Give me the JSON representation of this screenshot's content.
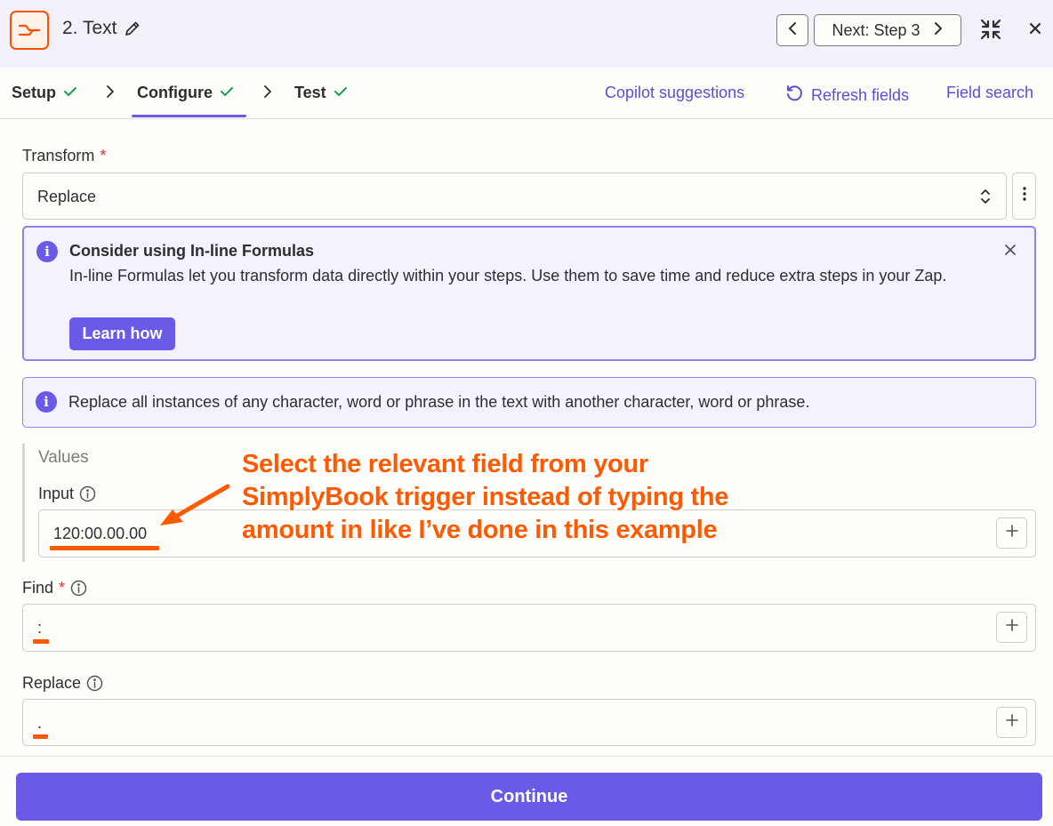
{
  "header": {
    "step_title": "2. Text",
    "next_label": "Next: Step 3",
    "icons": {
      "app": "text-formatter-icon",
      "edit": "pencil-icon",
      "prev": "chevron-left-icon",
      "next": "chevron-right-icon",
      "collapse": "collapse-icon",
      "close": "close-icon"
    }
  },
  "tabs": {
    "items": [
      {
        "label": "Setup",
        "status": "complete"
      },
      {
        "label": "Configure",
        "status": "complete",
        "active": true
      },
      {
        "label": "Test",
        "status": "complete"
      }
    ],
    "links": {
      "copilot": "Copilot suggestions",
      "refresh": "Refresh fields",
      "field_search": "Field search"
    }
  },
  "form": {
    "transform_label": "Transform",
    "required_mark": "*",
    "transform_value": "Replace",
    "notice": {
      "title": "Consider using In-line Formulas",
      "body": "In-line Formulas let you transform data directly within your steps. Use them to save time and reduce extra steps in your Zap.",
      "button": "Learn how"
    },
    "hint": "Replace all instances of any character, word or phrase in the text with another character, word or phrase.",
    "values_title": "Values",
    "input_label": "Input",
    "input_value": "120:00.00.00",
    "find_label": "Find",
    "find_value": ":",
    "replace_label": "Replace",
    "replace_value": "."
  },
  "annotation": {
    "lines": [
      "Select the relevant field from your",
      "SimplyBook trigger instead of typing the",
      "amount in like I’ve done in this example"
    ]
  },
  "footer": {
    "continue_label": "Continue"
  },
  "colors": {
    "accent": "#695be8",
    "brand_orange": "#ff4f00",
    "annotation_orange": "#ff5a00",
    "success_green": "#1f9d55",
    "required_red": "#e0352b"
  }
}
